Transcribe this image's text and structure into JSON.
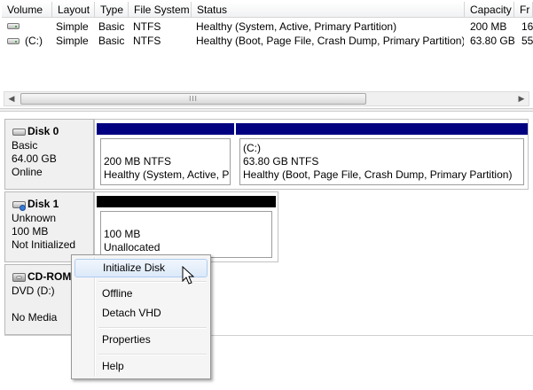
{
  "volume_list": {
    "columns": [
      "Volume",
      "Layout",
      "Type",
      "File System",
      "Status",
      "Capacity",
      "Fr"
    ],
    "rows": [
      {
        "volume": "",
        "layout": "Simple",
        "type": "Basic",
        "fs": "NTFS",
        "status": "Healthy (System, Active, Primary Partition)",
        "capacity": "200 MB",
        "free": "16"
      },
      {
        "volume": "(C:)",
        "layout": "Simple",
        "type": "Basic",
        "fs": "NTFS",
        "status": "Healthy (Boot, Page File, Crash Dump, Primary Partition)",
        "capacity": "63.80 GB",
        "free": "55"
      }
    ],
    "scrollbar": {
      "left_arrow": "◀",
      "right_arrow": "▶",
      "grip": "III"
    }
  },
  "disks": [
    {
      "name": "Disk 0",
      "type": "Basic",
      "size": "64.00 GB",
      "status": "Online",
      "partitions": [
        {
          "label": "",
          "size_fs": "200 MB NTFS",
          "status": "Healthy (System, Active, Pr",
          "bar_color": "#000080"
        },
        {
          "label": "(C:)",
          "size_fs": "63.80 GB NTFS",
          "status": "Healthy (Boot, Page File, Crash Dump, Primary Partition)",
          "bar_color": "#000080"
        }
      ]
    },
    {
      "name": "Disk 1",
      "type": "Unknown",
      "size": "100 MB",
      "status": "Not Initialized",
      "partitions": [
        {
          "label": "",
          "size_fs": "100 MB",
          "status": "Unallocated",
          "bar_color": "#000000"
        }
      ]
    },
    {
      "name": "CD-ROM",
      "type": "DVD (D:)",
      "size": "",
      "status": "No Media"
    }
  ],
  "context_menu": {
    "items": [
      "Initialize Disk",
      "Offline",
      "Detach VHD",
      "Properties",
      "Help"
    ],
    "highlighted": "Initialize Disk"
  },
  "colors": {
    "primary_partition": "#000080",
    "unallocated": "#000000",
    "menu_highlight": "#dce9f9"
  }
}
